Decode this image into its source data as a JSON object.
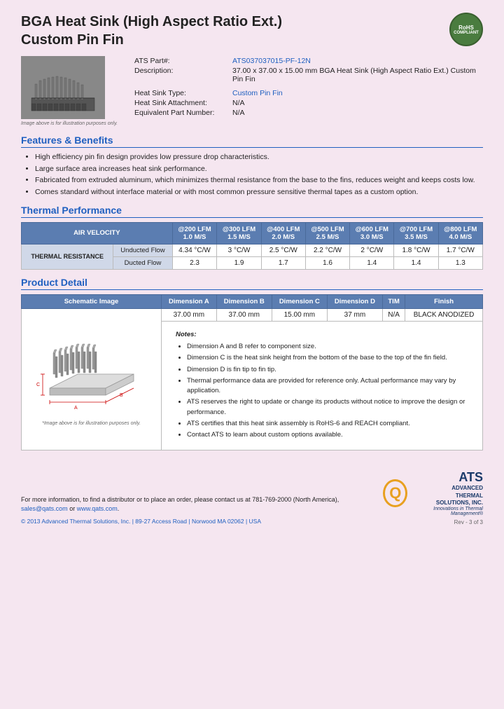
{
  "header": {
    "title_line1": "BGA Heat Sink (High Aspect Ratio Ext.)",
    "title_line2": "Custom Pin Fin",
    "rohs_line1": "RoHS",
    "rohs_line2": "COMPLIANT"
  },
  "part_info": {
    "part_number_label": "ATS Part#:",
    "part_number_value": "ATS037037015-PF-12N",
    "description_label": "Description:",
    "description_value": "37.00 x 37.00 x 15.00 mm  BGA Heat Sink (High Aspect Ratio Ext.) Custom Pin Fin",
    "heat_sink_type_label": "Heat Sink Type:",
    "heat_sink_type_value": "Custom Pin Fin",
    "attachment_label": "Heat Sink Attachment:",
    "attachment_value": "N/A",
    "equiv_part_label": "Equivalent Part Number:",
    "equiv_part_value": "N/A",
    "image_note": "Image above is for illustration purposes only."
  },
  "features": {
    "title": "Features & Benefits",
    "items": [
      "High efficiency pin fin design provides low pressure drop characteristics.",
      "Large surface area increases heat sink performance.",
      "Fabricated from extruded aluminum, which minimizes thermal resistance from the base to the fins, reduces weight and keeps costs low.",
      "Comes standard without interface material or with most common pressure sensitive thermal tapes as a custom option."
    ]
  },
  "thermal_performance": {
    "title": "Thermal Performance",
    "col_header": "AIR VELOCITY",
    "columns": [
      "@200 LFM\n1.0 M/S",
      "@300 LFM\n1.5 M/S",
      "@400 LFM\n2.0 M/S",
      "@500 LFM\n2.5 M/S",
      "@600 LFM\n3.0 M/S",
      "@700 LFM\n3.5 M/S",
      "@800 LFM\n4.0 M/S"
    ],
    "row_group": "THERMAL RESISTANCE",
    "rows": [
      {
        "label": "Unducted Flow",
        "values": [
          "4.34 °C/W",
          "3 °C/W",
          "2.5 °C/W",
          "2.2 °C/W",
          "2 °C/W",
          "1.8 °C/W",
          "1.7 °C/W"
        ]
      },
      {
        "label": "Ducted Flow",
        "values": [
          "2.3",
          "1.9",
          "1.7",
          "1.6",
          "1.4",
          "1.4",
          "1.3"
        ]
      }
    ]
  },
  "product_detail": {
    "title": "Product Detail",
    "columns": [
      "Schematic Image",
      "Dimension A",
      "Dimension B",
      "Dimension C",
      "Dimension D",
      "TIM",
      "Finish"
    ],
    "dim_values": [
      "37.00 mm",
      "37.00 mm",
      "15.00 mm",
      "37 mm",
      "N/A",
      "BLACK ANODIZED"
    ],
    "schematic_note": "*Image above is for illustration purposes only.",
    "notes_title": "Notes:",
    "notes": [
      "Dimension A and B refer to component size.",
      "Dimension C is the heat sink height from the bottom of the base to the top of the fin field.",
      "Dimension D is fin tip to fin tip.",
      "Thermal performance data are provided for reference only. Actual performance may vary by application.",
      "ATS reserves the right to update or change its products without notice to improve the design or performance.",
      "ATS certifies that this heat sink assembly is RoHS-6 and REACH compliant.",
      "Contact ATS to learn about custom options available."
    ]
  },
  "footer": {
    "contact_text": "For more information, to find a distributor or to place an order, please contact us at",
    "phone": "781-769-2000 (North America),",
    "email": "sales@qats.com",
    "email_connector": "or",
    "website": "www.qats.com",
    "copyright": "© 2013 Advanced Thermal Solutions, Inc. | 89-27 Access Road | Norwood MA  02062 | USA",
    "ats_name_big": "ATS",
    "ats_sub": "ADVANCED\nTHERMAL\nSOLUTIONS, INC.",
    "ats_tagline": "Innovations in Thermal Management®",
    "page_num": "Rev - 3 of 3"
  }
}
